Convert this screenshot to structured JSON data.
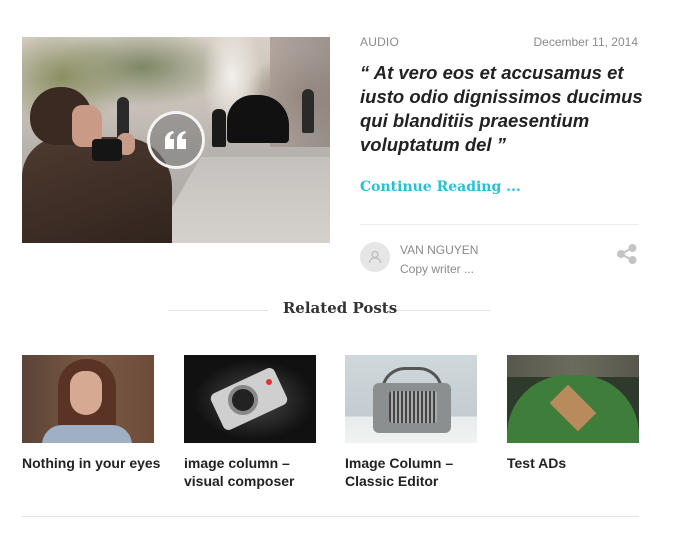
{
  "featured_post": {
    "category": "AUDIO",
    "date": "December 11, 2014",
    "quote": "“ At vero eos et accusamus et iusto odio dignissimos ducimus qui blanditiis praesentium voluptatum del ”",
    "continue_label": "Continue Reading ...",
    "author": {
      "name": "VAN NGUYEN",
      "role": "Copy writer ..."
    },
    "icons": {
      "format_badge": "quote-icon",
      "avatar": "user-icon",
      "share": "share-icon"
    }
  },
  "related": {
    "heading": "Related Posts",
    "posts": [
      {
        "title": "Nothing in your eyes",
        "thumb": "woman-portrait"
      },
      {
        "title": "image column – visual composer",
        "thumb": "camera"
      },
      {
        "title": "Image Column – Classic Editor",
        "thumb": "retro-radio"
      },
      {
        "title": "Test ADs",
        "thumb": "baseball-stadium"
      }
    ]
  },
  "colors": {
    "accent": "#2bbfd6",
    "meta_text": "#8a8a8a",
    "title_text": "#222222",
    "divider": "#e3e3e3"
  }
}
